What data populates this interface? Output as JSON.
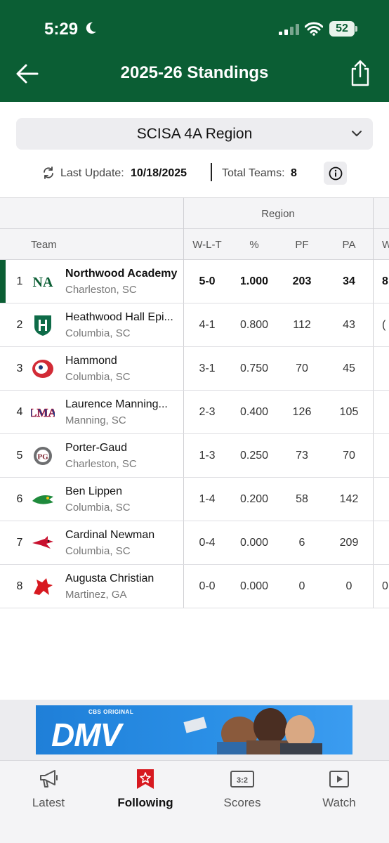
{
  "status_bar": {
    "time": "5:29",
    "battery": "52"
  },
  "header": {
    "title": "2025-26 Standings"
  },
  "region_select": {
    "selected": "SCISA 4A Region"
  },
  "update": {
    "last_update_label": "Last Update:",
    "last_update_value": "10/18/2025",
    "total_teams_label": "Total Teams:",
    "total_teams_value": "8"
  },
  "table": {
    "group_header": "Region",
    "columns": {
      "team": "Team",
      "wlt": "W-L-T",
      "pct": "%",
      "pf": "PF",
      "pa": "PA",
      "extra": "W"
    },
    "rows": [
      {
        "rank": "1",
        "name": "Northwood Academy",
        "location": "Charleston, SC",
        "wlt": "5-0",
        "pct": "1.000",
        "pf": "203",
        "pa": "34",
        "extra": "8",
        "logo": "northwood-logo-icon"
      },
      {
        "rank": "2",
        "name": "Heathwood Hall Epi...",
        "location": "Columbia, SC",
        "wlt": "4-1",
        "pct": "0.800",
        "pf": "112",
        "pa": "43",
        "extra": "(",
        "logo": "heathwood-logo-icon"
      },
      {
        "rank": "3",
        "name": "Hammond",
        "location": "Columbia, SC",
        "wlt": "3-1",
        "pct": "0.750",
        "pf": "70",
        "pa": "45",
        "extra": "",
        "logo": "hammond-logo-icon"
      },
      {
        "rank": "4",
        "name": "Laurence Manning...",
        "location": "Manning, SC",
        "wlt": "2-3",
        "pct": "0.400",
        "pf": "126",
        "pa": "105",
        "extra": "",
        "logo": "laurence-manning-logo-icon"
      },
      {
        "rank": "5",
        "name": "Porter-Gaud",
        "location": "Charleston, SC",
        "wlt": "1-3",
        "pct": "0.250",
        "pf": "73",
        "pa": "70",
        "extra": "",
        "logo": "porter-gaud-logo-icon"
      },
      {
        "rank": "6",
        "name": "Ben Lippen",
        "location": "Columbia, SC",
        "wlt": "1-4",
        "pct": "0.200",
        "pf": "58",
        "pa": "142",
        "extra": "",
        "logo": "ben-lippen-logo-icon"
      },
      {
        "rank": "7",
        "name": "Cardinal Newman",
        "location": "Columbia, SC",
        "wlt": "0-4",
        "pct": "0.000",
        "pf": "6",
        "pa": "209",
        "extra": "",
        "logo": "cardinal-newman-logo-icon"
      },
      {
        "rank": "8",
        "name": "Augusta Christian",
        "location": "Martinez, GA",
        "wlt": "0-0",
        "pct": "0.000",
        "pf": "0",
        "pa": "0",
        "extra": "0",
        "logo": "augusta-christian-logo-icon"
      }
    ]
  },
  "ad": {
    "tag": "CBS ORIGINAL",
    "logo_text": "DMV"
  },
  "tabs": [
    {
      "label": "Latest",
      "icon": "megaphone-icon"
    },
    {
      "label": "Following",
      "icon": "star-bookmark-icon"
    },
    {
      "label": "Scores",
      "icon": "scoreboard-icon"
    },
    {
      "label": "Watch",
      "icon": "play-icon"
    }
  ],
  "colors": {
    "brand_green": "#0b5e34",
    "following_red": "#d71920"
  }
}
